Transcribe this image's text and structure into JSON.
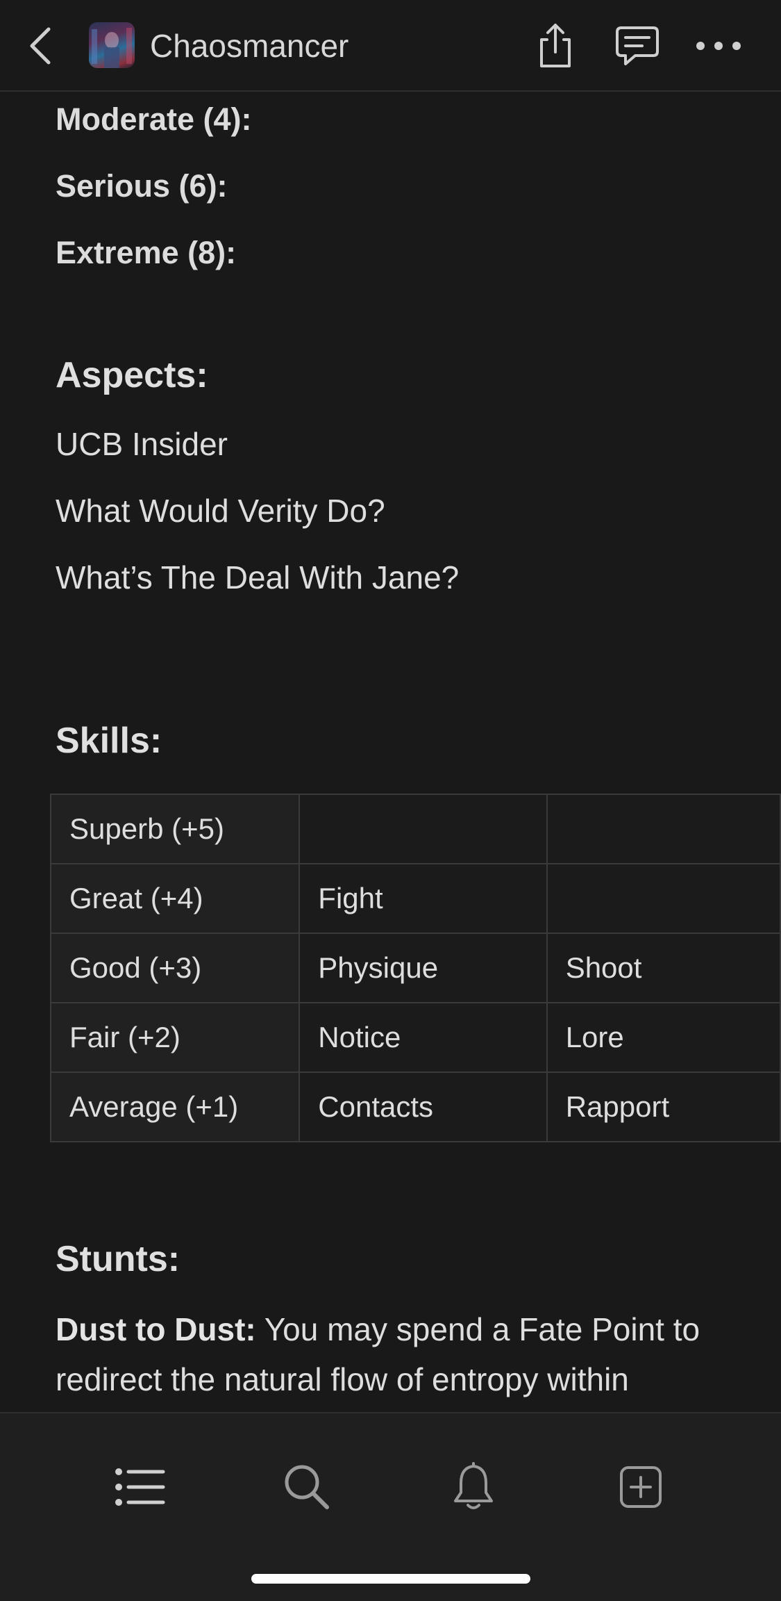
{
  "header": {
    "page_title": "Chaosmancer",
    "back_icon": "chevron-left-icon",
    "share_icon": "share-icon",
    "comment_icon": "comment-icon",
    "more_icon": "more-horizontal-icon"
  },
  "consequences": {
    "moderate": "Moderate (4):",
    "serious": "Serious (6):",
    "extreme": "Extreme (8):"
  },
  "aspects": {
    "heading": "Aspects:",
    "items": [
      "UCB Insider",
      "What Would Verity Do?",
      "What’s The Deal With Jane?"
    ]
  },
  "skills": {
    "heading": "Skills:",
    "rows": [
      [
        "Superb (+5)",
        "",
        ""
      ],
      [
        "Great (+4)",
        "Fight",
        ""
      ],
      [
        "Good (+3)",
        "Physique",
        "Shoot"
      ],
      [
        "Fair (+2)",
        "Notice",
        "Lore"
      ],
      [
        "Average (+1)",
        "Contacts",
        "Rapport"
      ]
    ]
  },
  "stunts": {
    "heading": "Stunts:",
    "first_name": "Dust to Dust:",
    "first_text": " You may spend a Fate Point to redirect the natural flow of entropy within"
  },
  "tabbar": {
    "list_icon": "list-icon",
    "search_icon": "search-icon",
    "notifications_icon": "bell-icon",
    "new_page_icon": "plus-square-icon"
  },
  "colors": {
    "background": "#191919",
    "text": "#dedede",
    "table_border": "#3a3a3a",
    "bar_background": "#1f1f1f"
  }
}
